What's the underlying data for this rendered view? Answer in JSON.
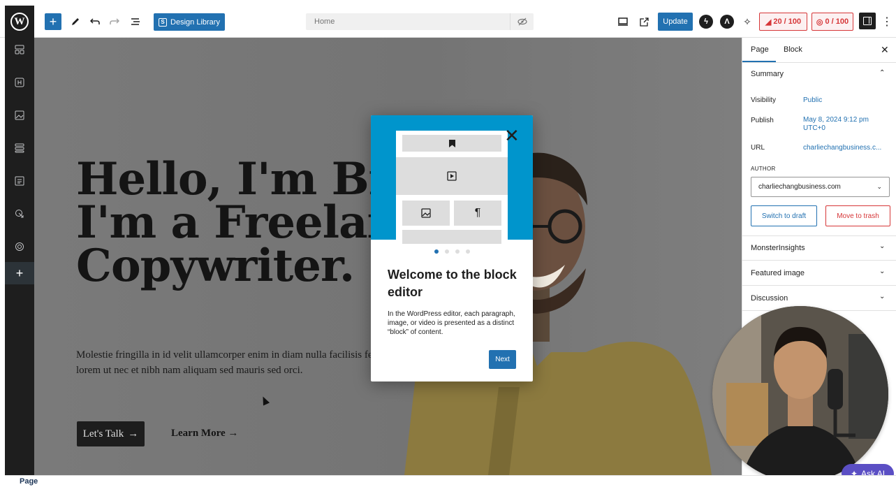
{
  "toolbar": {
    "design_library_label": "Design Library",
    "design_library_badge": "S",
    "document_title": "Home",
    "update_label": "Update",
    "score_one": "20 / 100",
    "score_two": "0 / 100",
    "icons": [
      "wordpress-logo",
      "plus-icon",
      "pencil-icon",
      "undo-icon",
      "redo-icon",
      "list-view-icon",
      "eye-slash-icon",
      "desktop-icon",
      "external-link-icon",
      "bolt-icon",
      "astra-icon",
      "sparkle-icon",
      "settings-panel-icon",
      "more-vertical-icon"
    ]
  },
  "sidebar": {
    "icons": [
      "grid-icon",
      "heading-icon",
      "image-icon",
      "stack-icon",
      "form-icon",
      "cursor-click-icon",
      "layers-icon",
      "plus-icon"
    ]
  },
  "canvas": {
    "heading": "Hello, I'm Bria\nI'm a Freelanc\nCopywriter.",
    "subtext": "Molestie fringilla in id velit ullamcorper enim in diam nulla facilisis felis lorem ut nec et nibh nam aliquam sed mauris sed orci.",
    "cta_primary": "Let's Talk",
    "cta_secondary": "Learn More"
  },
  "modal": {
    "close_glyph": "✕",
    "title": "Welcome to the block editor",
    "body": "In the WordPress editor, each paragraph, image, or video is presented as a distinct “block” of content.",
    "next_label": "Next",
    "total_steps": 4,
    "current_step": 1,
    "brand_color": "#0095cc"
  },
  "settings_panel": {
    "tabs": [
      "Page",
      "Block"
    ],
    "active_tab": "Page",
    "summary_title": "Summary",
    "rows": [
      {
        "label": "Visibility",
        "value": "Public"
      },
      {
        "label": "Publish",
        "value": "May 8, 2024 9:12 pm UTC+0"
      },
      {
        "label": "URL",
        "value": "charliechangbusiness.c..."
      }
    ],
    "author_label": "AUTHOR",
    "author_value": "charliechangbusiness.com",
    "switch_draft_label": "Switch to draft",
    "trash_label": "Move to trash",
    "sections": [
      "MonsterInsights",
      "Featured image",
      "Discussion"
    ]
  },
  "ask_ai_label": "Ask AI",
  "footer_label": "Page",
  "colors": {
    "accent": "#2271b1",
    "danger": "#d63638",
    "sidebar_bg": "#1e1e1e",
    "ask_ai": "#5b4fc4"
  }
}
